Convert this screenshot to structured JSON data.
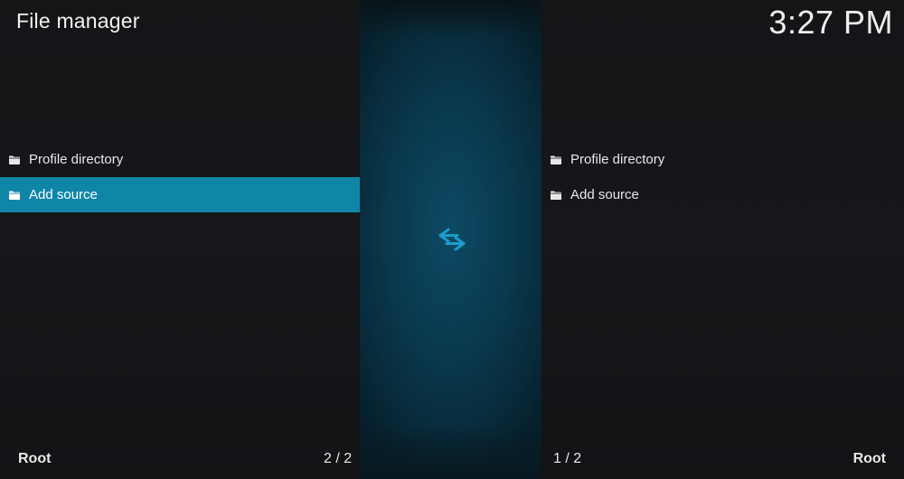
{
  "header": {
    "title": "File manager",
    "clock": "3:27 PM"
  },
  "left_pane": {
    "items": [
      {
        "label": "Profile directory",
        "icon": "folder-icon",
        "selected": false
      },
      {
        "label": "Add source",
        "icon": "folder-icon",
        "selected": true
      }
    ],
    "footer_path": "Root",
    "footer_count": "2 / 2"
  },
  "right_pane": {
    "items": [
      {
        "label": "Profile directory",
        "icon": "folder-icon",
        "selected": false
      },
      {
        "label": "Add source",
        "icon": "folder-icon",
        "selected": false
      }
    ],
    "footer_path": "Root",
    "footer_count": "1 / 2"
  },
  "center": {
    "icon": "swap-arrows-icon"
  },
  "colors": {
    "accent": "#0f86a8",
    "center_strip": "#0a3a4f",
    "swap_icon": "#1a9ccc",
    "background": "#141618",
    "text": "#e8e8e8"
  }
}
